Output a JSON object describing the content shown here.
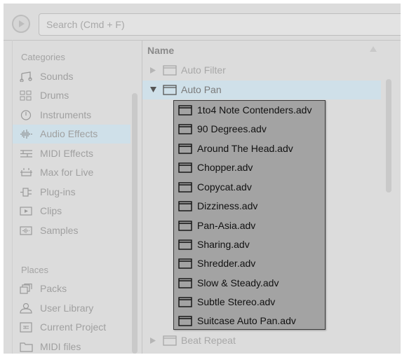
{
  "search": {
    "placeholder": "Search (Cmd + F)"
  },
  "sidebar": {
    "categories_title": "Categories",
    "categories": [
      {
        "label": "Sounds",
        "icon": "note-icon"
      },
      {
        "label": "Drums",
        "icon": "drum-grid-icon"
      },
      {
        "label": "Instruments",
        "icon": "clock-icon"
      },
      {
        "label": "Audio Effects",
        "icon": "waveform-icon",
        "selected": true
      },
      {
        "label": "MIDI Effects",
        "icon": "midi-effects-icon"
      },
      {
        "label": "Max for Live",
        "icon": "max-icon"
      },
      {
        "label": "Plug-ins",
        "icon": "plugin-icon"
      },
      {
        "label": "Clips",
        "icon": "clip-icon"
      },
      {
        "label": "Samples",
        "icon": "sample-icon"
      }
    ],
    "places_title": "Places",
    "places": [
      {
        "label": "Packs",
        "icon": "packs-icon"
      },
      {
        "label": "User Library",
        "icon": "user-icon"
      },
      {
        "label": "Current Project",
        "icon": "project-icon"
      },
      {
        "label": "MIDI files",
        "icon": "folder-icon"
      }
    ]
  },
  "browser": {
    "column_header": "Name",
    "rows": [
      {
        "label": "Auto Filter",
        "expanded": false
      },
      {
        "label": "Auto Pan",
        "expanded": true,
        "selected": true
      },
      {
        "label": "Beat Repeat",
        "expanded": false
      }
    ]
  },
  "popup": {
    "items": [
      "1to4 Note Contenders.adv",
      "90 Degrees.adv",
      "Around The Head.adv",
      "Chopper.adv",
      "Copycat.adv",
      "Dizziness.adv",
      "Pan-Asia.adv",
      "Sharing.adv",
      "Shredder.adv",
      "Slow & Steady.adv",
      "Subtle Stereo.adv",
      "Suitcase Auto Pan.adv"
    ]
  },
  "colors": {
    "background": "#dcdcdc",
    "selection": "#cfe0e9",
    "popup_background": "#a3a3a3",
    "muted_text": "#a0a0a0"
  }
}
